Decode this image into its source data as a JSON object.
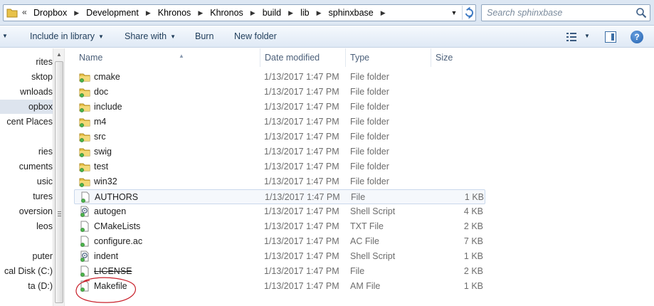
{
  "address": {
    "chevron": "«",
    "crumbs": [
      "Dropbox",
      "Development",
      "Khronos",
      "Khronos",
      "build",
      "lib",
      "sphinxbase"
    ]
  },
  "search": {
    "placeholder": "Search sphinxbase"
  },
  "toolbar": {
    "include_label": "Include in library",
    "share_label": "Share with",
    "burn_label": "Burn",
    "newfolder_label": "New folder",
    "help_glyph": "?"
  },
  "nav": {
    "items": [
      "rites",
      "sktop",
      "wnloads",
      "opbox",
      "cent Places",
      "ries",
      "cuments",
      "usic",
      "tures",
      "oversion",
      "leos",
      "puter",
      "cal Disk (C:)",
      "ta (D:)"
    ]
  },
  "columns": {
    "name": "Name",
    "date": "Date modified",
    "type": "Type",
    "size": "Size"
  },
  "colors": {
    "folder": "#e8c24a",
    "accent": "#1f5fae",
    "annotation": "#c8202a"
  },
  "files": [
    {
      "name": "cmake",
      "date": "1/13/2017 1:47 PM",
      "type": "File folder",
      "size": "",
      "icon": "folder-icon"
    },
    {
      "name": "doc",
      "date": "1/13/2017 1:47 PM",
      "type": "File folder",
      "size": "",
      "icon": "folder-icon"
    },
    {
      "name": "include",
      "date": "1/13/2017 1:47 PM",
      "type": "File folder",
      "size": "",
      "icon": "folder-icon"
    },
    {
      "name": "m4",
      "date": "1/13/2017 1:47 PM",
      "type": "File folder",
      "size": "",
      "icon": "folder-icon"
    },
    {
      "name": "src",
      "date": "1/13/2017 1:47 PM",
      "type": "File folder",
      "size": "",
      "icon": "folder-icon"
    },
    {
      "name": "swig",
      "date": "1/13/2017 1:47 PM",
      "type": "File folder",
      "size": "",
      "icon": "folder-icon"
    },
    {
      "name": "test",
      "date": "1/13/2017 1:47 PM",
      "type": "File folder",
      "size": "",
      "icon": "folder-icon"
    },
    {
      "name": "win32",
      "date": "1/13/2017 1:47 PM",
      "type": "File folder",
      "size": "",
      "icon": "folder-icon"
    },
    {
      "name": "AUTHORS",
      "date": "1/13/2017 1:47 PM",
      "type": "File",
      "size": "1 KB",
      "icon": "file-icon"
    },
    {
      "name": "autogen",
      "date": "1/13/2017 1:47 PM",
      "type": "Shell Script",
      "size": "4 KB",
      "icon": "script-file-icon"
    },
    {
      "name": "CMakeLists",
      "date": "1/13/2017 1:47 PM",
      "type": "TXT File",
      "size": "2 KB",
      "icon": "file-icon"
    },
    {
      "name": "configure.ac",
      "date": "1/13/2017 1:47 PM",
      "type": "AC File",
      "size": "7 KB",
      "icon": "file-icon"
    },
    {
      "name": "indent",
      "date": "1/13/2017 1:47 PM",
      "type": "Shell Script",
      "size": "1 KB",
      "icon": "script-file-icon"
    },
    {
      "name": "LICENSE",
      "date": "1/13/2017 1:47 PM",
      "type": "File",
      "size": "2 KB",
      "icon": "file-icon"
    },
    {
      "name": "Makefile",
      "date": "1/13/2017 1:47 PM",
      "type": "AM File",
      "size": "1 KB",
      "icon": "file-icon"
    }
  ]
}
